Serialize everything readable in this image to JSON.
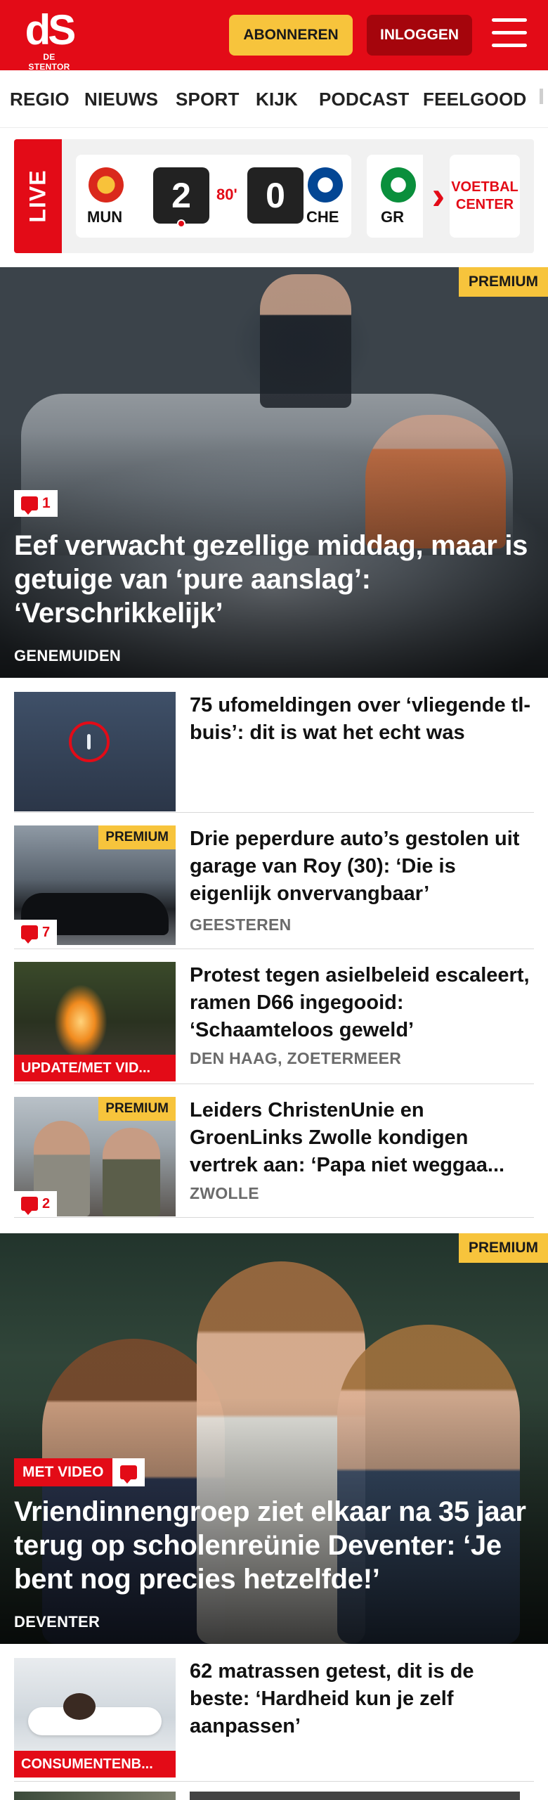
{
  "header": {
    "logo_mark": "dS",
    "logo_text": "DE STENTOR",
    "subscribe_label": "ABONNEREN",
    "login_label": "INLOGGEN",
    "brand_color": "#e30b17",
    "accent_color": "#f7c43c"
  },
  "nav": {
    "items": [
      "REGIO",
      "NIEUWS",
      "SPORT",
      "KIJK",
      "PODCAST",
      "FEELGOOD"
    ]
  },
  "live": {
    "label": "LIVE",
    "match": {
      "home_code": "MUN",
      "away_code": "CHE",
      "home_score": "2",
      "away_score": "0",
      "minute": "80'"
    },
    "next_team_code": "GR",
    "center_label_1": "VOETBAL",
    "center_label_2": "CENTER"
  },
  "hero1": {
    "premium": "PREMIUM",
    "comments": "1",
    "title": "Eef verwacht gezellige middag, maar is getuige van ‘pure aanslag’: ‘Verschrikkelijk’",
    "location": "GENEMUIDEN"
  },
  "articles": [
    {
      "title": "75 ufomeldingen over ‘vliegende tl-buis’: dit is wat het echt was",
      "location": ""
    },
    {
      "title": "Drie peperdure auto’s gestolen uit garage van Roy (30): ‘Die is eigenlijk onvervangbaar’",
      "location": "GEESTEREN",
      "premium": "PREMIUM",
      "comments": "7"
    },
    {
      "title": "Protest tegen asielbeleid escaleert, ramen D66 ingegooid: ‘Schaamteloos geweld’",
      "location": "DEN HAAG, ZOETERMEER",
      "label": "UPDATE/MET VID..."
    },
    {
      "title": "Leiders ChristenUnie en GroenLinks Zwolle kondigen vertrek aan: ‘Papa niet weggaa...",
      "location": "ZWOLLE",
      "premium": "PREMIUM",
      "comments": "2"
    }
  ],
  "hero2": {
    "premium": "PREMIUM",
    "video_label": "MET VIDEO",
    "title": "Vriendinnengroep ziet elkaar na 35 jaar terug op scholenreünie Deventer: ‘Je bent nog precies hetzelfde!’",
    "location": "DEVENTER"
  },
  "articles2": [
    {
      "title": "62 matrassen getest, dit is de beste: ‘Hardheid kun je zelf aanpassen’",
      "label": "CONSUMENTENB..."
    }
  ]
}
